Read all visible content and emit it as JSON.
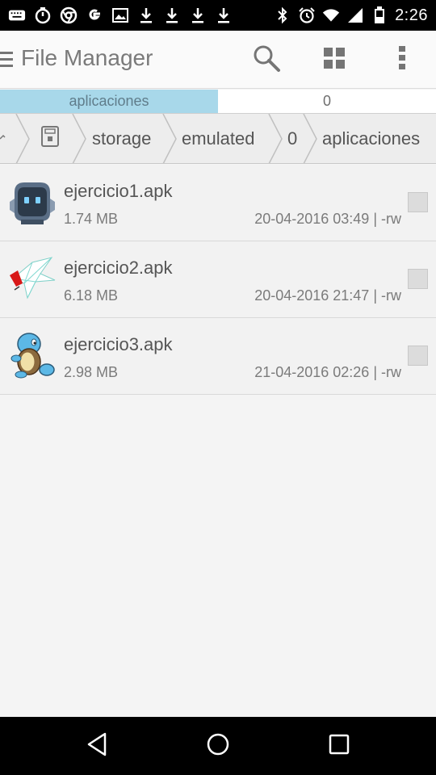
{
  "status_bar": {
    "time": "2:26",
    "left_icons": [
      "keyboard-icon",
      "stopwatch-icon",
      "chrome-icon",
      "google-icon",
      "image-icon",
      "download-icon",
      "download-icon",
      "download-icon",
      "download-icon"
    ],
    "right_icons": [
      "bluetooth-icon",
      "alarm-icon",
      "wifi-icon",
      "signal-icon",
      "battery-icon"
    ]
  },
  "app_bar": {
    "title": "File Manager",
    "actions": [
      "search-icon",
      "grid-view-icon",
      "more-vert-icon"
    ]
  },
  "tabs": [
    {
      "label": "aplicaciones",
      "active": true
    },
    {
      "label": "0",
      "active": false
    }
  ],
  "breadcrumb": {
    "items": [
      "storage",
      "emulated",
      "0",
      "aplicaciones"
    ]
  },
  "files": [
    {
      "name": "ejercicio1.apk",
      "size": "1.74 MB",
      "meta": "20-04-2016 03:49 | -rw",
      "icon": "app-icon-robot"
    },
    {
      "name": "ejercicio2.apk",
      "size": "6.18 MB",
      "meta": "20-04-2016 21:47 | -rw",
      "icon": "app-icon-bird"
    },
    {
      "name": "ejercicio3.apk",
      "size": "2.98 MB",
      "meta": "21-04-2016 02:26 | -rw",
      "icon": "app-icon-squirtle"
    }
  ],
  "nav_bar": [
    "back-icon",
    "home-icon",
    "recents-icon"
  ],
  "colors": {
    "accent_tab": "#a8d8ea",
    "status_bar_bg": "#000000",
    "app_bar_bg": "#fafafa"
  }
}
